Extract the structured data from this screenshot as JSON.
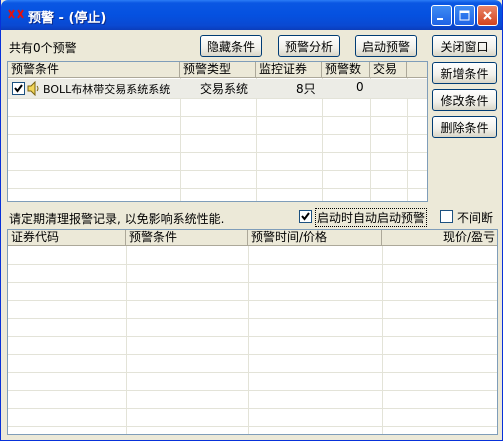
{
  "window": {
    "title": "预警 - (停止)",
    "icon": "warning-logo-icon"
  },
  "toolbar": {
    "count_label": "共有0个预警",
    "hide_conditions": "隐藏条件",
    "analysis": "预警分析",
    "start_warning": "启动预警",
    "close_window": "关闭窗口"
  },
  "side_buttons": {
    "add_condition": "新增条件",
    "modify_condition": "修改条件",
    "delete_condition": "删除条件"
  },
  "conditions_table": {
    "columns": [
      "预警条件",
      "预警类型",
      "监控证券",
      "预警数",
      "交易"
    ],
    "rows": [
      {
        "checked": true,
        "icon": "speaker-icon",
        "condition": "BOLL布林带交易系统系统",
        "type": "交易系统",
        "securities": "8只",
        "count": "0",
        "trade": ""
      }
    ]
  },
  "options": {
    "notice": "请定期清理报警记录, 以免影响系统性能.",
    "auto_start_label": "启动时自动启动预警",
    "auto_start_checked": true,
    "no_interrupt_label": "不间断",
    "no_interrupt_checked": false
  },
  "records_table": {
    "columns": [
      "证券代码",
      "预警条件",
      "预警时间/价格",
      "现价/盈亏"
    ]
  },
  "colors": {
    "title_bar": "#0551e0",
    "face": "#ece9d8",
    "selected_row": "#ecece6"
  }
}
